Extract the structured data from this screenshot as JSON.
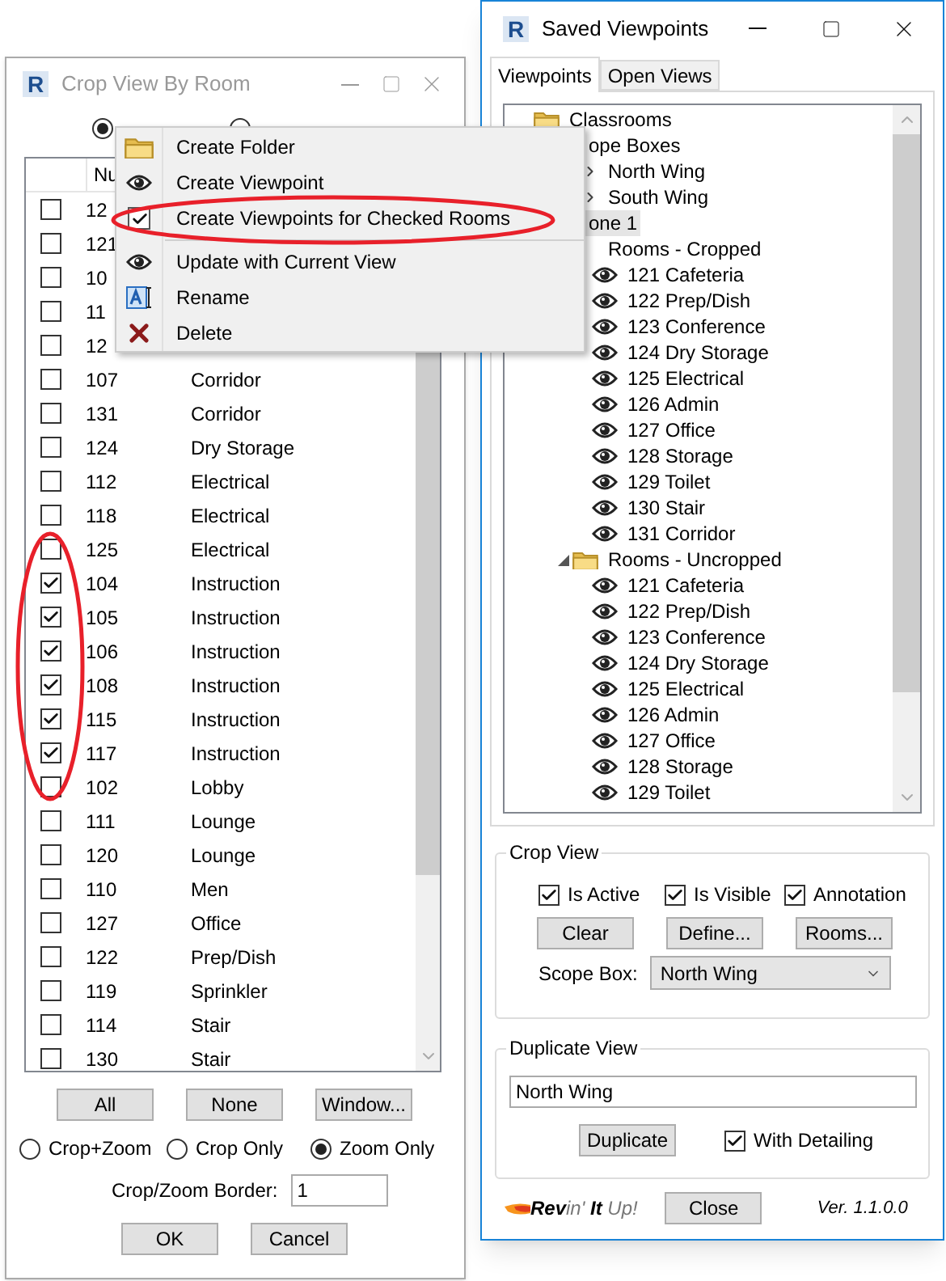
{
  "crop_window": {
    "icon_letter": "R",
    "title": "Crop View By Room",
    "top_radios": [
      {
        "selected": true
      },
      {
        "selected": false
      }
    ],
    "table": {
      "columns": [
        "Nu"
      ],
      "rows": [
        {
          "checked": false,
          "number": "12"
        },
        {
          "checked": false,
          "number": "121"
        },
        {
          "checked": false,
          "number": "10"
        },
        {
          "checked": false,
          "number": "11"
        },
        {
          "checked": false,
          "number": "12"
        },
        {
          "checked": false,
          "number": "107",
          "name": "Corridor"
        },
        {
          "checked": false,
          "number": "131",
          "name": "Corridor"
        },
        {
          "checked": false,
          "number": "124",
          "name": "Dry Storage"
        },
        {
          "checked": false,
          "number": "112",
          "name": "Electrical"
        },
        {
          "checked": false,
          "number": "118",
          "name": "Electrical"
        },
        {
          "checked": false,
          "number": "125",
          "name": "Electrical"
        },
        {
          "checked": true,
          "number": "104",
          "name": "Instruction"
        },
        {
          "checked": true,
          "number": "105",
          "name": "Instruction"
        },
        {
          "checked": true,
          "number": "106",
          "name": "Instruction"
        },
        {
          "checked": true,
          "number": "108",
          "name": "Instruction"
        },
        {
          "checked": true,
          "number": "115",
          "name": "Instruction"
        },
        {
          "checked": true,
          "number": "117",
          "name": "Instruction"
        },
        {
          "checked": false,
          "number": "102",
          "name": "Lobby"
        },
        {
          "checked": false,
          "number": "111",
          "name": "Lounge"
        },
        {
          "checked": false,
          "number": "120",
          "name": "Lounge"
        },
        {
          "checked": false,
          "number": "110",
          "name": "Men"
        },
        {
          "checked": false,
          "number": "127",
          "name": "Office"
        },
        {
          "checked": false,
          "number": "122",
          "name": "Prep/Dish"
        },
        {
          "checked": false,
          "number": "119",
          "name": "Sprinkler"
        },
        {
          "checked": false,
          "number": "114",
          "name": "Stair"
        },
        {
          "checked": false,
          "number": "130",
          "name": "Stair"
        }
      ]
    },
    "buttons": [
      "All",
      "None",
      "Window..."
    ],
    "modes": [
      {
        "label": "Crop+Zoom",
        "selected": false
      },
      {
        "label": "Crop Only",
        "selected": false
      },
      {
        "label": "Zoom Only",
        "selected": true
      }
    ],
    "border": {
      "label": "Crop/Zoom Border:",
      "value": "1"
    },
    "actions": [
      "OK",
      "Cancel"
    ]
  },
  "context_menu": {
    "items": [
      {
        "kind": "folder",
        "label": "Create Folder"
      },
      {
        "kind": "viewpoint",
        "label": "Create Viewpoint"
      },
      {
        "kind": "check",
        "label": "Create Viewpoints for Checked Rooms"
      },
      {
        "kind": "separator"
      },
      {
        "kind": "viewpoint",
        "label": "Update with Current View"
      },
      {
        "kind": "rename",
        "label": "Rename"
      },
      {
        "kind": "delete",
        "label": "Delete"
      }
    ]
  },
  "viewpoints_window": {
    "icon_letter": "R",
    "title": "Saved Viewpoints",
    "tabs": [
      {
        "label": "Viewpoints",
        "selected": true
      },
      {
        "label": "Open Views",
        "selected": false
      }
    ],
    "tree": [
      {
        "label": "Classrooms",
        "kind": "folder",
        "selected": false,
        "children": [
          {
            "label": "ope Boxes",
            "selected": false,
            "children": [
              {
                "label": "North Wing",
                "expanded": false,
                "selected": false
              },
              {
                "label": "South Wing",
                "expanded": false,
                "selected": false
              }
            ]
          },
          {
            "label": "one 1",
            "selected": true,
            "children": [
              {
                "label": "Rooms - Cropped",
                "selected": false,
                "children": [
                  {
                    "label": "121 Cafeteria",
                    "kind": "viewpoint",
                    "selected": false
                  },
                  {
                    "label": "122 Prep/Dish",
                    "kind": "viewpoint",
                    "selected": false
                  },
                  {
                    "label": "123 Conference",
                    "kind": "viewpoint",
                    "selected": false
                  },
                  {
                    "label": "124 Dry Storage",
                    "kind": "viewpoint",
                    "selected": false
                  },
                  {
                    "label": "125 Electrical",
                    "kind": "viewpoint",
                    "selected": false
                  },
                  {
                    "label": "126 Admin",
                    "kind": "viewpoint",
                    "selected": false
                  },
                  {
                    "label": "127 Office",
                    "kind": "viewpoint",
                    "selected": false
                  },
                  {
                    "label": "128 Storage",
                    "kind": "viewpoint",
                    "selected": false
                  },
                  {
                    "label": "129 Toilet",
                    "kind": "viewpoint",
                    "selected": false
                  },
                  {
                    "label": "130 Stair",
                    "kind": "viewpoint",
                    "selected": false
                  },
                  {
                    "label": "131 Corridor",
                    "kind": "viewpoint",
                    "selected": false
                  }
                ]
              },
              {
                "label": "Rooms - Uncropped",
                "kind": "folder",
                "expanded": true,
                "selected": false,
                "children": [
                  {
                    "label": "121 Cafeteria",
                    "kind": "viewpoint",
                    "selected": false
                  },
                  {
                    "label": "122 Prep/Dish",
                    "kind": "viewpoint",
                    "selected": false
                  },
                  {
                    "label": "123 Conference",
                    "kind": "viewpoint",
                    "selected": false
                  },
                  {
                    "label": "124 Dry Storage",
                    "kind": "viewpoint",
                    "selected": false
                  },
                  {
                    "label": "125 Electrical",
                    "kind": "viewpoint",
                    "selected": false
                  },
                  {
                    "label": "126 Admin",
                    "kind": "viewpoint",
                    "selected": false
                  },
                  {
                    "label": "127 Office",
                    "kind": "viewpoint",
                    "selected": false
                  },
                  {
                    "label": "128 Storage",
                    "kind": "viewpoint",
                    "selected": false
                  },
                  {
                    "label": "129 Toilet",
                    "kind": "viewpoint",
                    "selected": false
                  }
                ]
              }
            ]
          }
        ]
      }
    ],
    "crop_view": {
      "title": "Crop View",
      "options": [
        {
          "label": "Is Active",
          "checked": true
        },
        {
          "label": "Is Visible",
          "checked": true
        },
        {
          "label": "Annotation",
          "checked": true
        }
      ],
      "buttons": [
        "Clear",
        "Define...",
        "Rooms..."
      ],
      "scope_box": {
        "label": "Scope Box:",
        "value": "North Wing"
      }
    },
    "duplicate_view": {
      "title": "Duplicate View",
      "name": "North Wing",
      "button": "Duplicate",
      "with_detailing": {
        "label": "With Detailing",
        "checked": true
      }
    },
    "footer": {
      "logo": "**Rev**in' **It** Up!",
      "close": "Close",
      "version": "Ver. 1.1.0.0"
    }
  }
}
